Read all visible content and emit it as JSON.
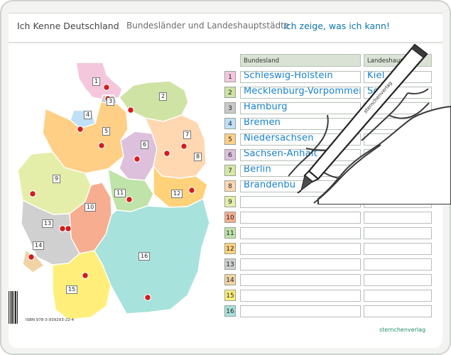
{
  "header": {
    "title": "Ich Kenne Deutschland",
    "subtitle": "Bundesländer und Landeshauptstädte",
    "slogan": "Ich zeige, was ich kann!"
  },
  "table": {
    "column_land": "Bundesland",
    "column_capital": "Landeshaupt",
    "rows": [
      {
        "num": "1",
        "land": "Schleswig-Holstein",
        "capital": "Kiel",
        "color": "#f4c7dc"
      },
      {
        "num": "2",
        "land": "Mecklenburg-Vorpommern",
        "capital": "Sch",
        "color": "#cfe3a4"
      },
      {
        "num": "3",
        "land": "Hamburg",
        "capital": "",
        "color": "#c9c9c9"
      },
      {
        "num": "4",
        "land": "Bremen",
        "capital": "",
        "color": "#bfe0f7"
      },
      {
        "num": "5",
        "land": "Niedersachsen",
        "capital": "",
        "color": "#ffcf86"
      },
      {
        "num": "6",
        "land": "Sachsen-Anhalt",
        "capital": "",
        "color": "#ddc0dc"
      },
      {
        "num": "7",
        "land": "Berlin",
        "capital": "",
        "color": "#d6e7a6"
      },
      {
        "num": "8",
        "land": "Brandenbu",
        "capital": "",
        "color": "#ffd7b0"
      },
      {
        "num": "9",
        "land": "",
        "capital": "",
        "color": "#e4eea8"
      },
      {
        "num": "10",
        "land": "",
        "capital": "",
        "color": "#f7ad8f"
      },
      {
        "num": "11",
        "land": "",
        "capital": "",
        "color": "#bfe3a8"
      },
      {
        "num": "12",
        "land": "",
        "capital": "",
        "color": "#ffd27a"
      },
      {
        "num": "13",
        "land": "",
        "capital": "",
        "color": "#cfd0cf"
      },
      {
        "num": "14",
        "land": "",
        "capital": "",
        "color": "#f1d3a4"
      },
      {
        "num": "15",
        "land": "",
        "capital": "",
        "color": "#ffef7a"
      },
      {
        "num": "16",
        "land": "",
        "capital": "",
        "color": "#a7e2dc"
      }
    ]
  },
  "map": {
    "labels": [
      "1",
      "2",
      "3",
      "4",
      "5",
      "6",
      "7",
      "8",
      "9",
      "10",
      "11",
      "12",
      "13",
      "14",
      "15",
      "16"
    ]
  },
  "footer": {
    "isbn": "ISBN 978-3-939293-22-4",
    "publisher": "sternchenverlag"
  },
  "pen": {
    "label": "sternchenverlag"
  }
}
